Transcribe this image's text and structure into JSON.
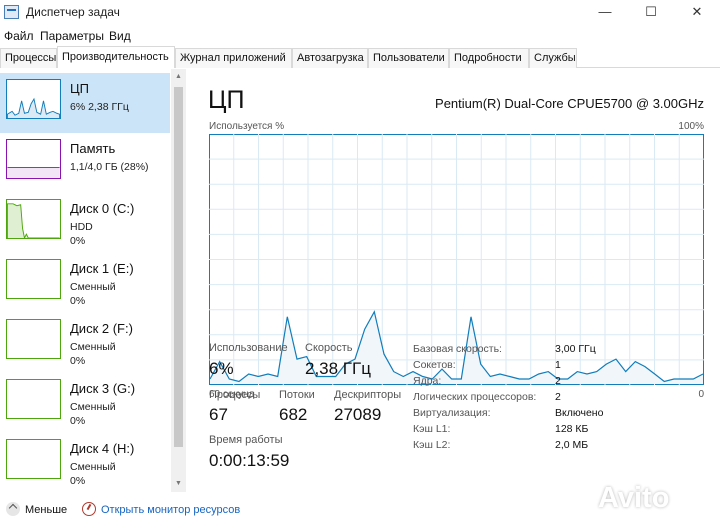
{
  "window": {
    "title": "Диспетчер задач",
    "controls": {
      "minimize": "—",
      "maximize": "☐",
      "close": "✕"
    }
  },
  "menu": [
    "Файл",
    "Параметры",
    "Вид"
  ],
  "tabs": [
    {
      "label": "Процессы",
      "active": false
    },
    {
      "label": "Производительность",
      "active": true
    },
    {
      "label": "Журнал приложений",
      "active": false
    },
    {
      "label": "Автозагрузка",
      "active": false
    },
    {
      "label": "Пользователи",
      "active": false
    },
    {
      "label": "Подробности",
      "active": false
    },
    {
      "label": "Службы",
      "active": false
    }
  ],
  "sidebar": {
    "items": [
      {
        "name": "ЦП",
        "lines": [
          "6% 2,38 ГГц"
        ],
        "color": "#117dbb",
        "selected": true
      },
      {
        "name": "Память",
        "lines": [
          "1,1/4,0 ГБ (28%)"
        ],
        "color": "#8b12ae",
        "selected": false
      },
      {
        "name": "Диск 0 (C:)",
        "lines": [
          "HDD",
          "0%"
        ],
        "color": "#4da60c",
        "selected": false
      },
      {
        "name": "Диск 1 (E:)",
        "lines": [
          "Сменный",
          "0%"
        ],
        "color": "#4da60c",
        "selected": false
      },
      {
        "name": "Диск 2 (F:)",
        "lines": [
          "Сменный",
          "0%"
        ],
        "color": "#4da60c",
        "selected": false
      },
      {
        "name": "Диск 3 (G:)",
        "lines": [
          "Сменный",
          "0%"
        ],
        "color": "#4da60c",
        "selected": false
      },
      {
        "name": "Диск 4 (H:)",
        "lines": [
          "Сменный",
          "0%"
        ],
        "color": "#4da60c",
        "selected": false
      }
    ]
  },
  "cpu": {
    "title": "ЦП",
    "model": "Pentium(R) Dual-Core CPUE5700 @ 3.00GHz",
    "util_label": "Используется %",
    "max_label": "100%",
    "time_label": "60 секунд",
    "min_label": "0",
    "stats": {
      "utilization": {
        "label": "Использование",
        "value": "6%"
      },
      "speed": {
        "label": "Скорость",
        "value": "2,38 ГГц"
      },
      "processes": {
        "label": "Процессы",
        "value": "67"
      },
      "threads": {
        "label": "Потоки",
        "value": "682"
      },
      "handles": {
        "label": "Дескрипторы",
        "value": "27089"
      },
      "uptime": {
        "label": "Время работы",
        "value": "0:00:13:59"
      }
    },
    "details": [
      {
        "key": "Базовая скорость:",
        "value": "3,00 ГГц"
      },
      {
        "key": "Сокетов:",
        "value": "1"
      },
      {
        "key": "Ядра:",
        "value": "2"
      },
      {
        "key": "Логических процессоров:",
        "value": "2"
      },
      {
        "key": "Виртуализация:",
        "value": "Включено"
      },
      {
        "key": "Кэш L1:",
        "value": "128 КБ"
      },
      {
        "key": "Кэш L2:",
        "value": "2,0 МБ"
      }
    ]
  },
  "graph_series": [
    2,
    9,
    2,
    1,
    4,
    3,
    4,
    3,
    27,
    10,
    11,
    3,
    3,
    3,
    8,
    10,
    22,
    29,
    12,
    5,
    3,
    5,
    3,
    2,
    6,
    2,
    2,
    27,
    8,
    3,
    4,
    3,
    2,
    2,
    4,
    5,
    2,
    2,
    5,
    4,
    5,
    8,
    10,
    5,
    9,
    7,
    4,
    1,
    2,
    2,
    2,
    4
  ],
  "colors": {
    "cpu_line": "#117dbb",
    "cpu_fill": "#f1f6fa",
    "grid": "#d9eaf4",
    "selected_bg": "#cce4f7",
    "link": "#1565c0"
  },
  "footer": {
    "fewer_label": "Меньше",
    "monitor_label": "Открыть монитор ресурсов"
  },
  "watermark": "Avito"
}
